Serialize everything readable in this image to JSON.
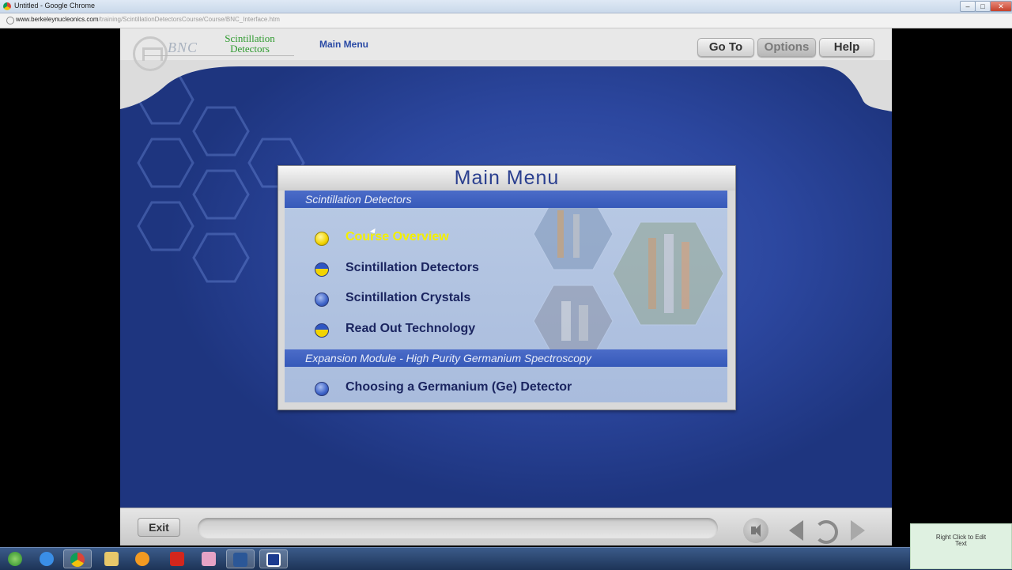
{
  "browser": {
    "window_title": "Untitled - Google Chrome",
    "url_host": "www.berkeleynucleonics.com",
    "url_path": "/training/ScintillationDetectorsCourse/Course/BNC_Interface.htm",
    "controls": [
      "–",
      "□",
      "✕"
    ]
  },
  "header": {
    "logo_text": "BNC",
    "course_title_line1": "Scintillation",
    "course_title_line2": "Detectors",
    "page_label": "Main Menu",
    "buttons": {
      "goto": "Go To",
      "options": "Options",
      "help": "Help"
    }
  },
  "menu": {
    "title": "Main Menu",
    "sections": [
      {
        "name": "Scintillation Detectors",
        "items": [
          {
            "label": "Course Overview",
            "bullet": "yellow",
            "active": true
          },
          {
            "label": "Scintillation Detectors",
            "bullet": "split",
            "active": false
          },
          {
            "label": "Scintillation Crystals",
            "bullet": "blue",
            "active": false
          },
          {
            "label": "Read Out Technology",
            "bullet": "split",
            "active": false
          }
        ]
      },
      {
        "name": "Expansion Module - High Purity Germanium Spectroscopy",
        "items": [
          {
            "label": "Choosing a Germanium (Ge) Detector",
            "bullet": "blue",
            "active": false
          }
        ]
      }
    ]
  },
  "footer": {
    "exit_label": "Exit"
  },
  "note": {
    "line1": "Right Click to Edit",
    "line2": "Text"
  },
  "taskbar": {
    "apps": [
      "start-icon",
      "ie-icon",
      "chrome-icon",
      "folder-icon",
      "media-icon",
      "acrobat-icon",
      "paint-icon",
      "word-icon",
      "app-icon"
    ]
  },
  "colors": {
    "app_bg": "#26409a",
    "menu_text": "#1b2560",
    "active_text": "#f4f000",
    "section_bar": "#3d60bf"
  }
}
